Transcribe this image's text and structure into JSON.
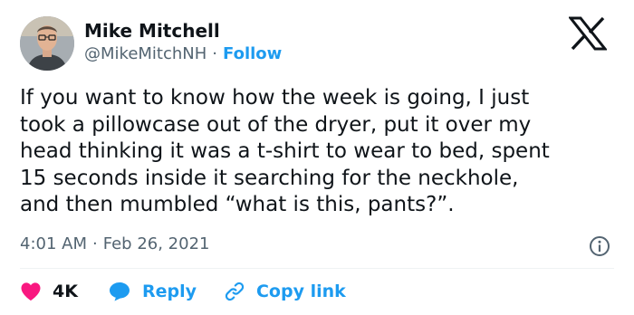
{
  "author": {
    "name": "Mike Mitchell",
    "handle": "@MikeMitchNH",
    "separator": "·",
    "follow_label": "Follow"
  },
  "tweet": {
    "text": "If you want to know how the week is going, I just\ntook a pillowcase out of the dryer, put it over my\nhead thinking it was a t-shirt to wear to bed, spent\n15 seconds inside it searching for the neckhole,\nand then mumbled “what is this, pants?”."
  },
  "meta": {
    "time": "4:01 AM",
    "separator": "·",
    "date": "Feb 26, 2021"
  },
  "actions": {
    "like_count": "4K",
    "reply_label": "Reply",
    "copy_link_label": "Copy link"
  },
  "colors": {
    "accent": "#1d9bf0",
    "like": "#f91880",
    "text": "#0f1419",
    "secondary": "#536471"
  },
  "icons": [
    "x-logo-icon",
    "info-icon",
    "heart-icon",
    "reply-bubble-icon",
    "link-icon"
  ]
}
